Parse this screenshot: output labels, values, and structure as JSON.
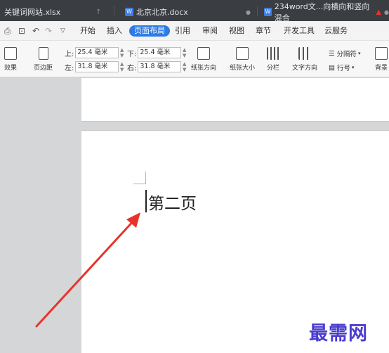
{
  "tabs": [
    {
      "label": "关键词网站.xlsx"
    },
    {
      "label": "北京北京.docx"
    },
    {
      "label": "234word文...向横向和竖向混合"
    }
  ],
  "menu": {
    "items": [
      "开始",
      "插入",
      "页面布局",
      "引用",
      "审阅",
      "视图",
      "章节",
      "开发工具",
      "云服务"
    ],
    "active": "页面布局"
  },
  "toolbar": {
    "effects_label": "效果",
    "margins_label": "页边距",
    "top_label": "上:",
    "top_value": "25.4 毫米",
    "bottom_label": "下:",
    "bottom_value": "25.4 毫米",
    "left_label": "左:",
    "left_value": "31.8 毫米",
    "right_label": "右:",
    "right_value": "31.8 毫米",
    "orientation_label": "纸张方向",
    "size_label": "纸张大小",
    "columns_label": "分栏",
    "text_dir_label": "文字方向",
    "separator_label": "分隔符",
    "line_num_label": "行号",
    "background_label": "背景"
  },
  "document": {
    "page2_text": "第二页"
  },
  "watermark": "最需网",
  "colors": {
    "accent": "#2d7be5",
    "arrow": "#e8332b",
    "watermark": "#4a3ccf"
  }
}
